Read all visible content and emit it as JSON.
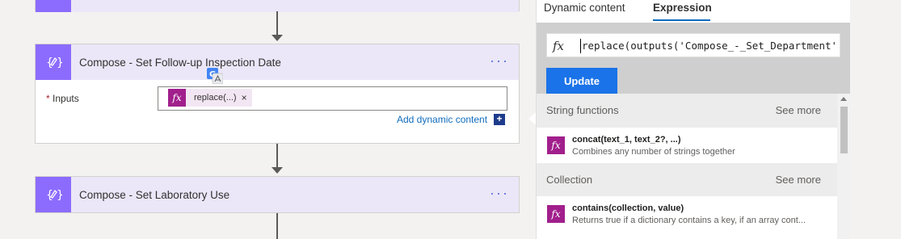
{
  "cards": {
    "top": {
      "title": ""
    },
    "followup": {
      "title": "Compose - Set Follow-up Inspection Date",
      "more": "···",
      "inputs_required": "*",
      "inputs_label": "Inputs",
      "token_text": "replace(...)",
      "token_remove": "×",
      "add_dynamic": "Add dynamic content",
      "add_dynamic_plus": "+"
    },
    "laboratory": {
      "title": "Compose - Set Laboratory Use",
      "more": "···"
    }
  },
  "panel": {
    "tabs": [
      {
        "label": "Dynamic content",
        "active": false
      },
      {
        "label": "Expression",
        "active": true
      }
    ],
    "expression": {
      "fx": "fx",
      "value": "replace(outputs('Compose_-_Set_Department'"
    },
    "update_label": "Update",
    "sections": [
      {
        "title": "String functions",
        "see_more": "See more",
        "item": {
          "signature": "concat(text_1, text_2?, ...)",
          "description": "Combines any number of strings together"
        }
      },
      {
        "title": "Collection",
        "see_more": "See more",
        "item": {
          "signature": "contains(collection, value)",
          "description": "Returns true if a dictionary contains a key, if an array cont..."
        }
      }
    ]
  },
  "icons": {
    "compose": "compose-icon",
    "fx": "fx-icon",
    "translate": "google-translate-icon"
  },
  "colors": {
    "compose_accent": "#8c6cff",
    "card_header_bg": "#ebe7f8",
    "fx_badge": "#a11f8c",
    "link_blue": "#0f6cbd",
    "update_button": "#1a73e8"
  }
}
